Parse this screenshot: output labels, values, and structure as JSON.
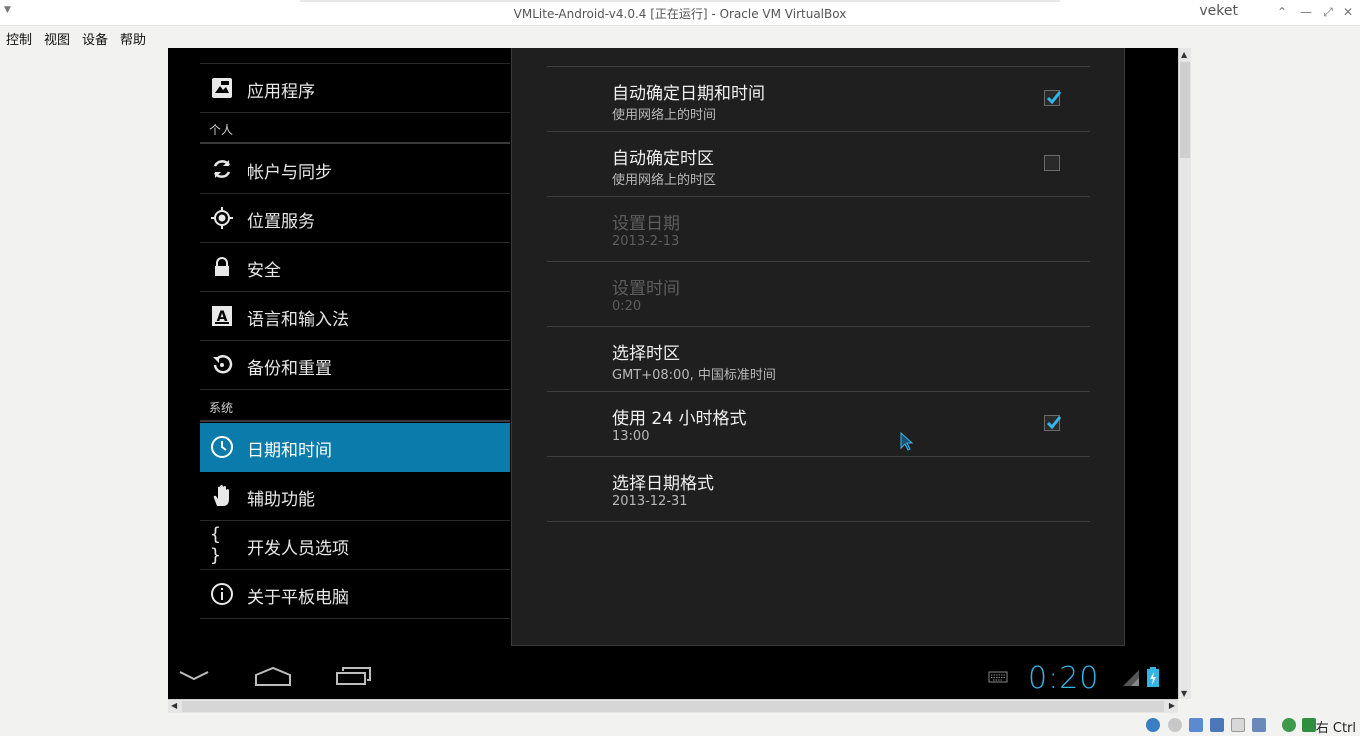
{
  "window": {
    "title": "VMLite-Android-v4.0.4 [正在运行] - Oracle VM VirtualBox",
    "user": "veket"
  },
  "menubar": {
    "items": [
      "控制",
      "视图",
      "设备",
      "帮助"
    ]
  },
  "settings_left": {
    "item_apps": "应用程序",
    "header_personal": "个人",
    "item_accounts": "帐户与同步",
    "item_location": "位置服务",
    "item_security": "安全",
    "item_language": "语言和输入法",
    "item_backup": "备份和重置",
    "header_system": "系统",
    "item_datetime": "日期和时间",
    "item_accessibility": "辅助功能",
    "item_developer": "开发人员选项",
    "item_about": "关于平板电脑"
  },
  "datetime": {
    "items": [
      {
        "title": "自动确定日期和时间",
        "summary": "使用网络上的时间",
        "checked": true,
        "enabled": true
      },
      {
        "title": "自动确定时区",
        "summary": "使用网络上的时区",
        "checked": false,
        "enabled": true
      },
      {
        "title": "设置日期",
        "summary": "2013-2-13",
        "enabled": false
      },
      {
        "title": "设置时间",
        "summary": "0:20",
        "enabled": false
      },
      {
        "title": "选择时区",
        "summary": "GMT+08:00, 中国标准时间",
        "enabled": true
      },
      {
        "title": "使用 24 小时格式",
        "summary": "13:00",
        "checked": true,
        "enabled": true
      },
      {
        "title": "选择日期格式",
        "summary": "2013-12-31",
        "enabled": true
      }
    ]
  },
  "navbar": {
    "clock": "0:20"
  },
  "statusbar": {
    "host_key": "右 Ctrl"
  },
  "colors": {
    "accent": "#33b5e5",
    "selected": "#0a7bab"
  }
}
